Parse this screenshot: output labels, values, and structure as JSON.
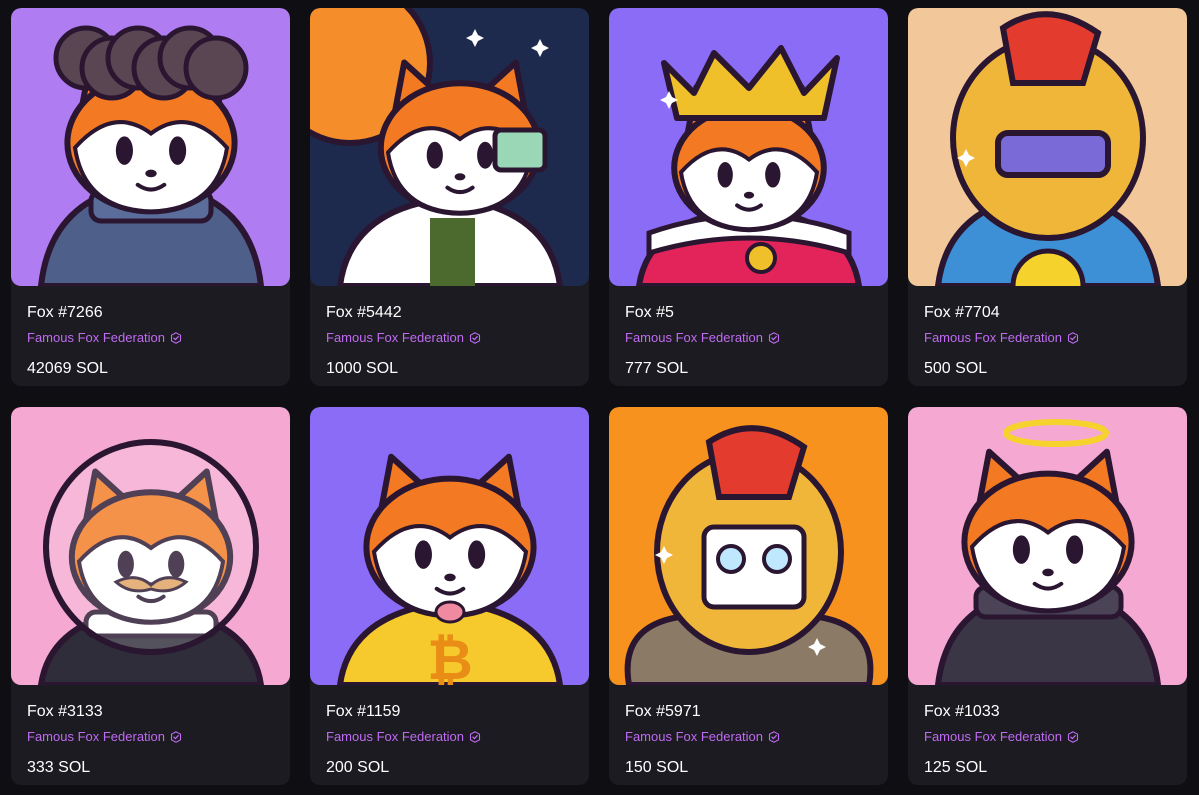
{
  "colors": {
    "page_bg": "#0f0f13",
    "card_bg": "#1b1b21",
    "collection_text": "#c06bf2",
    "fur_orange": "#f37a22",
    "outline": "#2a1630"
  },
  "items": [
    {
      "name": "Fox #7266",
      "collection": "Famous Fox Federation",
      "price": "42069 SOL",
      "bg": "#b07cf2",
      "art": "afro-sweater",
      "accent": "#4e5f8a",
      "verified_icon": "verified-badge-icon"
    },
    {
      "name": "Fox #5442",
      "collection": "Famous Fox Federation",
      "price": "1000 SOL",
      "bg": "#1d2a4d",
      "art": "space-scientist",
      "accent": "#ffffff",
      "verified_icon": "verified-badge-icon"
    },
    {
      "name": "Fox #5",
      "collection": "Famous Fox Federation",
      "price": "777 SOL",
      "bg": "#8b6cf6",
      "art": "king-crown",
      "accent": "#f0c02a",
      "verified_icon": "verified-badge-icon"
    },
    {
      "name": "Fox #7704",
      "collection": "Famous Fox Federation",
      "price": "500 SOL",
      "bg": "#f2c89a",
      "art": "gold-helmet-hoodie",
      "accent": "#3d8fd6",
      "verified_icon": "verified-badge-icon"
    },
    {
      "name": "Fox #3133",
      "collection": "Famous Fox Federation",
      "price": "333 SOL",
      "bg": "#f5a8d1",
      "art": "astronaut-general",
      "accent": "#2f2d3a",
      "verified_icon": "verified-badge-icon"
    },
    {
      "name": "Fox #1159",
      "collection": "Famous Fox Federation",
      "price": "200 SOL",
      "bg": "#8b6cf6",
      "art": "bitcoin-shirt",
      "accent": "#f6c92c",
      "verified_icon": "verified-badge-icon"
    },
    {
      "name": "Fox #5971",
      "collection": "Famous Fox Federation",
      "price": "150 SOL",
      "bg": "#f7921e",
      "art": "gold-helmet-fur",
      "accent": "#8b7a66",
      "verified_icon": "verified-badge-icon"
    },
    {
      "name": "Fox #1033",
      "collection": "Famous Fox Federation",
      "price": "125 SOL",
      "bg": "#f5a8d1",
      "art": "halo-sweater",
      "accent": "#3b3646",
      "verified_icon": "verified-badge-icon"
    }
  ]
}
